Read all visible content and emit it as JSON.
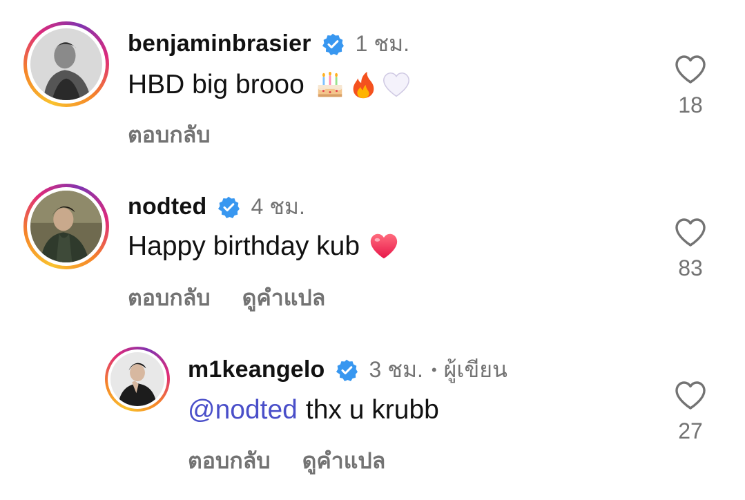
{
  "comments": [
    {
      "username": "benjaminbrasier",
      "time": "1 ชม.",
      "text": "HBD big brooo",
      "emojis": [
        "cake-emoji",
        "fire-emoji",
        "white-heart-emoji"
      ],
      "reply_label": "ตอบกลับ",
      "likes": "18"
    },
    {
      "username": "nodted",
      "time": "4 ชม.",
      "text": "Happy birthday kub",
      "emojis": [
        "red-heart-emoji"
      ],
      "reply_label": "ตอบกลับ",
      "translate_label": "ดูคำแปล",
      "likes": "83"
    },
    {
      "username": "m1keangelo",
      "time": "3 ชม.",
      "separator": "•",
      "author_label": "ผู้เขียน",
      "mention": "@nodted",
      "text": "thx u krubb",
      "reply_label": "ตอบกลับ",
      "translate_label": "ดูคำแปล",
      "likes": "27"
    }
  ],
  "colors": {
    "verified_blue": "#3897f0",
    "mention": "#4a4fc9",
    "muted": "#737373"
  },
  "icons": [
    "verified-badge-icon",
    "heart-outline-icon"
  ]
}
